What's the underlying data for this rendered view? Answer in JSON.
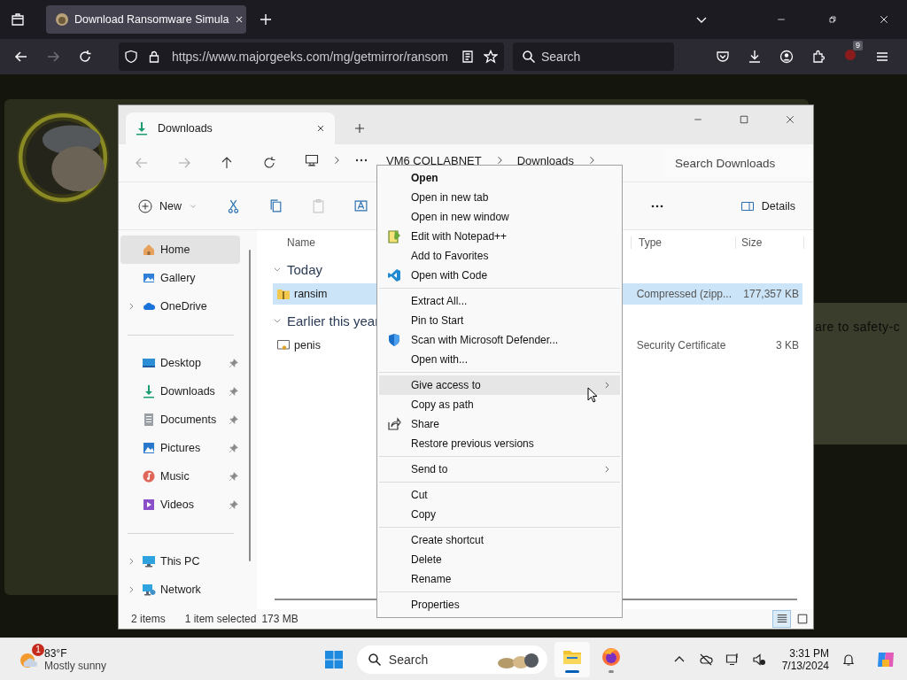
{
  "browser": {
    "tabs": [
      {
        "title": "Download Ransomware Simula",
        "selected": true
      }
    ],
    "url": "https://www.majorgeeks.com/mg/getmirror/ransom",
    "search": {
      "placeholder": "Search"
    },
    "extension_badge": "9"
  },
  "page": {
    "text_fragment": "are to safety-c"
  },
  "explorer": {
    "tabs": [
      {
        "title": "Downloads",
        "selected": true
      }
    ],
    "breadcrumb": [
      "VM6 COLLABNET",
      "Downloads"
    ],
    "search": {
      "placeholder": "Search Downloads"
    },
    "new_label": "New",
    "toolbar_actions": [
      {
        "kind": "cut",
        "disabled": false
      },
      {
        "kind": "copy",
        "disabled": false
      },
      {
        "kind": "paste",
        "disabled": true
      },
      {
        "kind": "rename",
        "disabled": false
      }
    ],
    "details_label": "Details",
    "sidebar": [
      {
        "items": [
          {
            "label": "Home",
            "kind": "home",
            "selected": true,
            "expandable": false,
            "pinned": false
          },
          {
            "label": "Gallery",
            "kind": "gallery",
            "selected": false,
            "expandable": false,
            "pinned": false
          },
          {
            "label": "OneDrive",
            "kind": "onedrive",
            "selected": false,
            "expandable": true,
            "pinned": false
          }
        ]
      },
      {
        "items": [
          {
            "label": "Desktop",
            "kind": "desktop",
            "selected": false,
            "expandable": false,
            "pinned": true
          },
          {
            "label": "Downloads",
            "kind": "downloads",
            "selected": false,
            "expandable": false,
            "pinned": true
          },
          {
            "label": "Documents",
            "kind": "documents",
            "selected": false,
            "expandable": false,
            "pinned": true
          },
          {
            "label": "Pictures",
            "kind": "pictures",
            "selected": false,
            "expandable": false,
            "pinned": true
          },
          {
            "label": "Music",
            "kind": "music",
            "selected": false,
            "expandable": false,
            "pinned": true
          },
          {
            "label": "Videos",
            "kind": "videos",
            "selected": false,
            "expandable": false,
            "pinned": true
          }
        ]
      },
      {
        "items": [
          {
            "label": "This PC",
            "kind": "thispc",
            "selected": false,
            "expandable": true,
            "pinned": false
          },
          {
            "label": "Network",
            "kind": "network",
            "selected": false,
            "expandable": true,
            "pinned": false
          }
        ]
      }
    ],
    "columns": [
      "Name",
      "Type",
      "Size"
    ],
    "groups": [
      {
        "label": "Today",
        "expanded": true,
        "files": [
          {
            "name": "ransim",
            "kind": "zip",
            "type": "Compressed (zipp...",
            "size": "177,357 KB",
            "selected": true
          }
        ]
      },
      {
        "label": "Earlier this year",
        "expanded": true,
        "files": [
          {
            "name": "penis",
            "kind": "cert",
            "type": "Security Certificate",
            "size": "3 KB",
            "selected": false
          }
        ]
      }
    ],
    "status": {
      "count": "2 items",
      "selection": "1 item selected",
      "size": "173 MB"
    },
    "views": [
      {
        "kind": "details",
        "selected": true
      },
      {
        "kind": "tiles",
        "selected": false
      }
    ]
  },
  "context_menu": {
    "sections": [
      {
        "items": [
          {
            "label": "Open",
            "default": true,
            "submenu": false,
            "hovered": false
          },
          {
            "label": "Open in new tab",
            "default": false,
            "submenu": false,
            "hovered": false
          },
          {
            "label": "Open in new window",
            "default": false,
            "submenu": false,
            "hovered": false
          },
          {
            "label": "Edit with Notepad++",
            "kind": "notepad",
            "default": false,
            "submenu": false,
            "hovered": false
          },
          {
            "label": "Add to Favorites",
            "default": false,
            "submenu": false,
            "hovered": false
          },
          {
            "label": "Open with Code",
            "kind": "vscode",
            "default": false,
            "submenu": false,
            "hovered": false
          }
        ]
      },
      {
        "items": [
          {
            "label": "Extract All...",
            "default": false,
            "submenu": false,
            "hovered": false
          },
          {
            "label": "Pin to Start",
            "default": false,
            "submenu": false,
            "hovered": false
          },
          {
            "label": "Scan with Microsoft Defender...",
            "kind": "defender",
            "default": false,
            "submenu": false,
            "hovered": false
          },
          {
            "label": "Open with...",
            "default": false,
            "submenu": false,
            "hovered": false
          }
        ]
      },
      {
        "items": [
          {
            "label": "Give access to",
            "default": false,
            "submenu": true,
            "hovered": true
          },
          {
            "label": "Copy as path",
            "default": false,
            "submenu": false,
            "hovered": false
          },
          {
            "label": "Share",
            "kind": "share",
            "default": false,
            "submenu": false,
            "hovered": false
          },
          {
            "label": "Restore previous versions",
            "default": false,
            "submenu": false,
            "hovered": false
          }
        ]
      },
      {
        "items": [
          {
            "label": "Send to",
            "default": false,
            "submenu": true,
            "hovered": false
          }
        ]
      },
      {
        "items": [
          {
            "label": "Cut",
            "default": false,
            "submenu": false,
            "hovered": false
          },
          {
            "label": "Copy",
            "default": false,
            "submenu": false,
            "hovered": false
          }
        ]
      },
      {
        "items": [
          {
            "label": "Create shortcut",
            "default": false,
            "submenu": false,
            "hovered": false
          },
          {
            "label": "Delete",
            "default": false,
            "submenu": false,
            "hovered": false
          },
          {
            "label": "Rename",
            "default": false,
            "submenu": false,
            "hovered": false
          }
        ]
      },
      {
        "items": [
          {
            "label": "Properties",
            "default": false,
            "submenu": false,
            "hovered": false
          }
        ]
      }
    ]
  },
  "taskbar": {
    "weather": {
      "badge": "1",
      "temperature": "83°F",
      "condition": "Mostly sunny"
    },
    "search": {
      "placeholder": "Search"
    },
    "apps": [
      {
        "kind": "explorer",
        "active": true
      },
      {
        "kind": "firefox",
        "active": false
      }
    ],
    "clock": {
      "time": "3:31 PM",
      "date": "7/13/2024"
    }
  }
}
